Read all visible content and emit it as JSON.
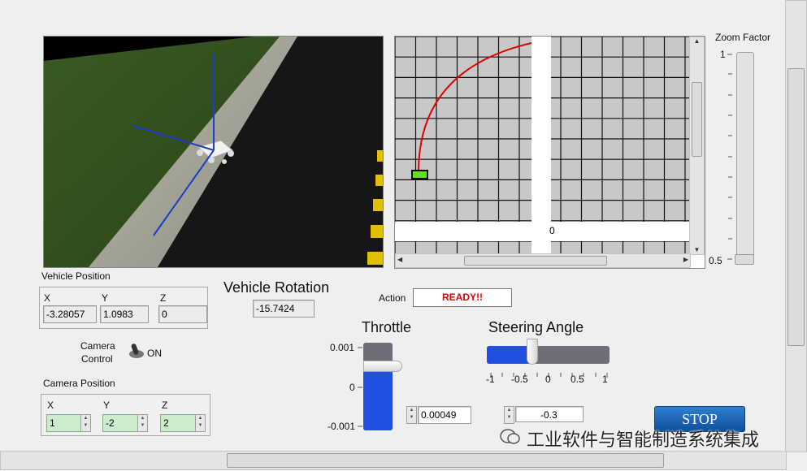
{
  "vehicle_position": {
    "title": "Vehicle Position",
    "x_label": "X",
    "y_label": "Y",
    "z_label": "Z",
    "x": "-3.28057",
    "y": "1.0983",
    "z": "0"
  },
  "vehicle_rotation": {
    "title": "Vehicle Rotation",
    "value": "-15.7424"
  },
  "action": {
    "label": "Action",
    "value": "READY!!"
  },
  "camera_control": {
    "label_line1": "Camera",
    "label_line2": "Control",
    "state": "ON"
  },
  "camera_position": {
    "title": "Camera Position",
    "x_label": "X",
    "y_label": "Y",
    "z_label": "Z",
    "x": "1",
    "y": "-2",
    "z": "2"
  },
  "throttle": {
    "title": "Throttle",
    "ticks": [
      "0.001",
      "0",
      "-0.001"
    ],
    "value": "0.00049",
    "level_fraction": 0.745
  },
  "steering": {
    "title": "Steering Angle",
    "ticks": [
      "-1",
      "-0.5",
      "0",
      "0.5",
      "1"
    ],
    "value": "-0.3"
  },
  "zoom": {
    "title": "Zoom Factor",
    "max_label": "1",
    "min_label": "0.5"
  },
  "map": {
    "origin_label": "0"
  },
  "stop_label": "STOP",
  "watermark": "工业软件与智能制造系统集成",
  "colors": {
    "track": "#e00000",
    "action_text": "#e00000",
    "slider_fill": "#2050e0",
    "vehicle": "#60e020"
  }
}
